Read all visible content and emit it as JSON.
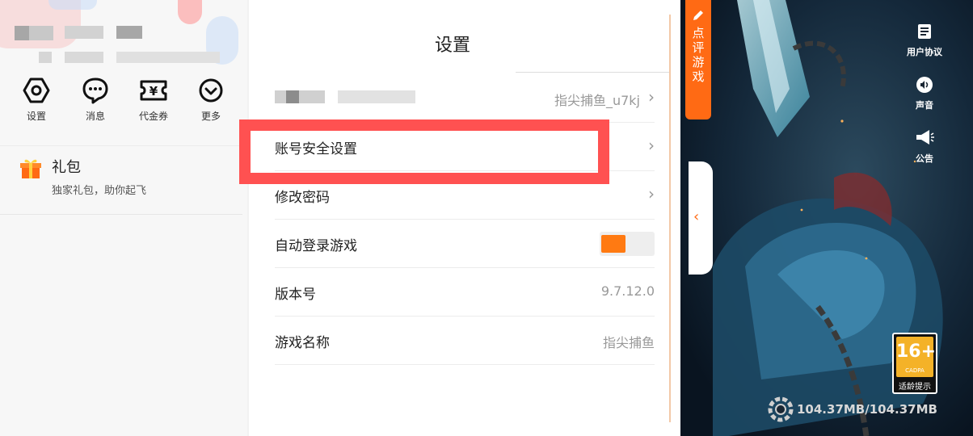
{
  "left_panel": {
    "icons": [
      {
        "id": "settings",
        "label": "设置",
        "icon": "hexagon-settings-icon"
      },
      {
        "id": "messages",
        "label": "消息",
        "icon": "chat-bubble-icon"
      },
      {
        "id": "vouchers",
        "label": "代金券",
        "icon": "ticket-yen-icon"
      },
      {
        "id": "more",
        "label": "更多",
        "icon": "chevron-circle-icon"
      }
    ],
    "gift": {
      "title": "礼包",
      "subtitle": "独家礼包，助你起飞",
      "icon": "gift-icon"
    }
  },
  "settings": {
    "title": "设置",
    "account_value": "指尖捕鱼_u7kj",
    "rows": {
      "security": {
        "label": "账号安全设置"
      },
      "password": {
        "label": "修改密码"
      },
      "auto_login": {
        "label": "自动登录游戏",
        "enabled": true
      },
      "version": {
        "label": "版本号",
        "value": "9.7.12.0"
      },
      "game_name": {
        "label": "游戏名称",
        "value": "指尖捕鱼"
      }
    },
    "colors": {
      "accent": "#ff7a12",
      "highlight": "#ff5151"
    }
  },
  "game_side": {
    "review_tab": {
      "chars": [
        "点",
        "评",
        "游",
        "戏"
      ],
      "icon": "pencil-icon"
    },
    "buttons": [
      {
        "id": "agreement",
        "label": "用户协议",
        "icon": "document-icon"
      },
      {
        "id": "sound",
        "label": "声音",
        "icon": "speaker-icon"
      },
      {
        "id": "notice",
        "label": "公告",
        "icon": "megaphone-icon"
      }
    ],
    "age_rating": {
      "number": "16+",
      "org": "CADPA",
      "text": "适龄提示"
    },
    "download": "104.37MB/104.37MB",
    "collapse_icon": "chevron-left-icon"
  }
}
